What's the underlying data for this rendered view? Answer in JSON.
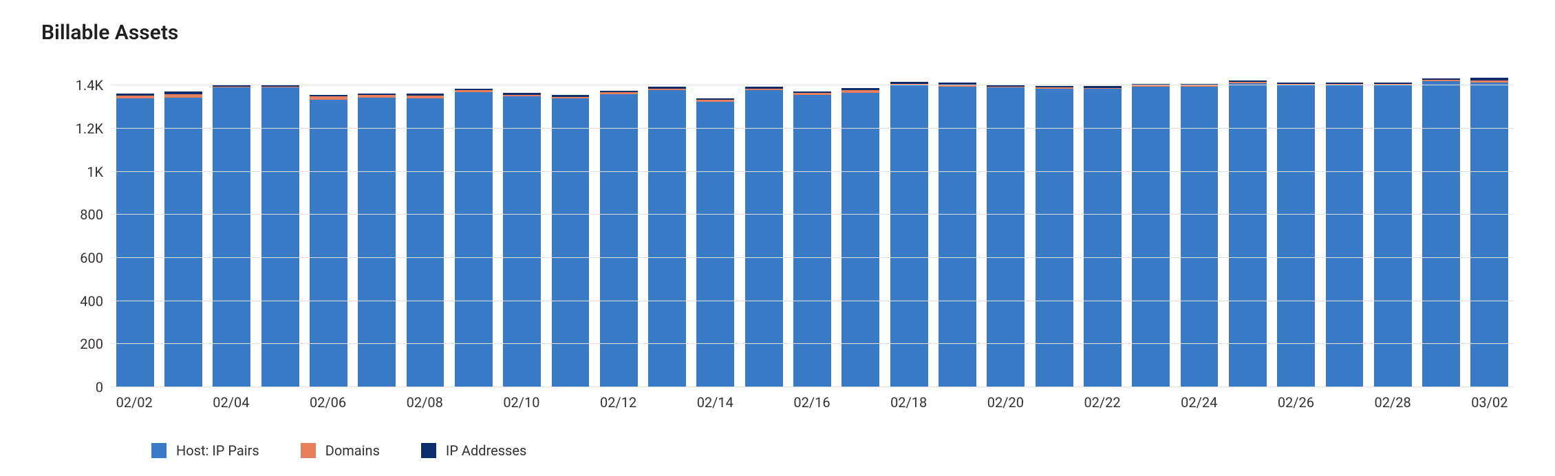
{
  "title": "Billable Assets",
  "colors": {
    "host_ip_pairs": "#3a7bc8",
    "domains": "#e88060",
    "ip_addresses": "#0b2d6b",
    "grid": "#e1dfdd"
  },
  "legend": [
    {
      "key": "host_ip_pairs",
      "label": "Host: IP Pairs"
    },
    {
      "key": "domains",
      "label": "Domains"
    },
    {
      "key": "ip_addresses",
      "label": "IP Addresses"
    }
  ],
  "chart_data": {
    "type": "bar",
    "stacked": true,
    "title": "Billable Assets",
    "xlabel": "",
    "ylabel": "",
    "ylim": [
      0,
      1500
    ],
    "y_ticks": [
      0,
      200,
      400,
      600,
      800,
      1000,
      1200,
      1400
    ],
    "y_tick_labels": [
      "0",
      "200",
      "400",
      "600",
      "800",
      "1K",
      "1.2K",
      "1.4K"
    ],
    "grid": true,
    "legend_position": "bottom-left",
    "categories": [
      "02/02",
      "02/03",
      "02/04",
      "02/05",
      "02/06",
      "02/07",
      "02/08",
      "02/09",
      "02/10",
      "02/11",
      "02/12",
      "02/13",
      "02/14",
      "02/15",
      "02/16",
      "02/17",
      "02/18",
      "02/19",
      "02/20",
      "02/21",
      "02/22",
      "02/23",
      "02/24",
      "02/25",
      "02/26",
      "02/27",
      "02/28",
      "03/01",
      "03/02"
    ],
    "x_tick_every": 2,
    "series": [
      {
        "name": "Host: IP Pairs",
        "key": "host_ip_pairs",
        "values": [
          1340,
          1345,
          1390,
          1390,
          1335,
          1345,
          1340,
          1370,
          1350,
          1340,
          1360,
          1380,
          1325,
          1380,
          1355,
          1365,
          1400,
          1395,
          1390,
          1385,
          1385,
          1395,
          1395,
          1410,
          1400,
          1400,
          1400,
          1420,
          1415
        ]
      },
      {
        "name": "Domains",
        "key": "domains",
        "values": [
          14,
          14,
          6,
          6,
          14,
          10,
          14,
          8,
          8,
          8,
          8,
          6,
          8,
          6,
          10,
          14,
          6,
          8,
          6,
          6,
          4,
          6,
          6,
          6,
          6,
          6,
          6,
          6,
          10
        ]
      },
      {
        "name": "IP Addresses",
        "key": "ip_addresses",
        "values": [
          10,
          14,
          8,
          8,
          8,
          8,
          8,
          8,
          8,
          8,
          8,
          8,
          8,
          8,
          8,
          10,
          10,
          10,
          8,
          8,
          8,
          8,
          8,
          8,
          8,
          8,
          8,
          8,
          10
        ]
      }
    ]
  }
}
